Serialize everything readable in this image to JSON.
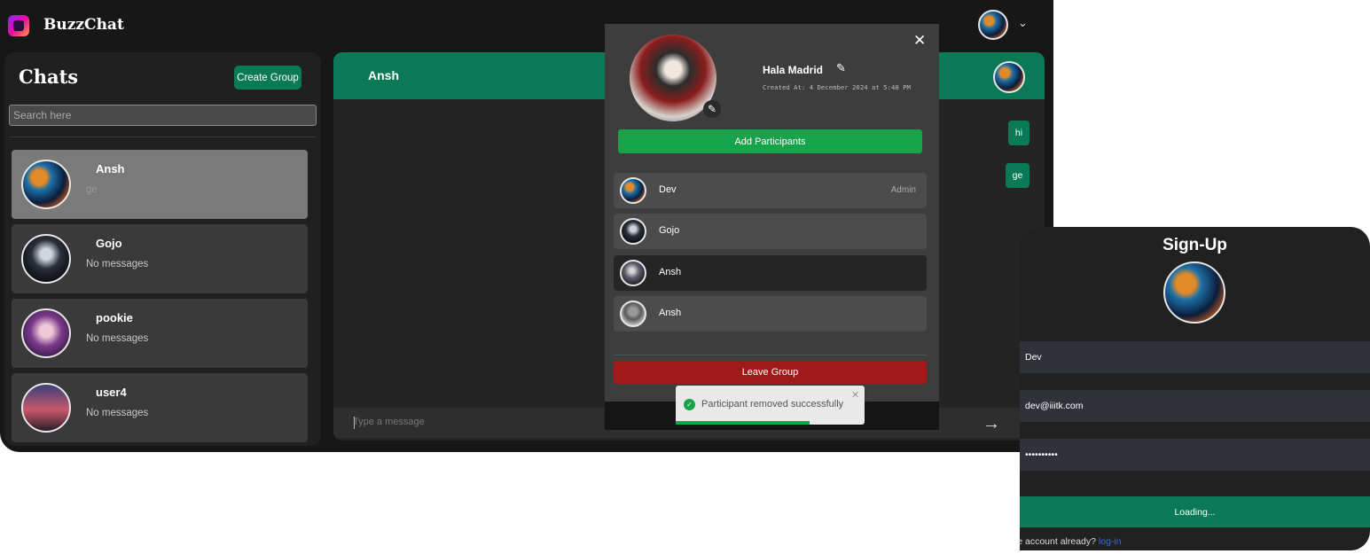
{
  "app": {
    "brand": "BuzzChat",
    "top_avatar_icon": "user-avatar",
    "menu_icon": "chevron-down-icon"
  },
  "sidebar": {
    "title": "Chats",
    "create_group_label": "Create Group",
    "search_placeholder": "Search here",
    "chats": [
      {
        "name": "Ansh",
        "last_message": "ge",
        "active": true
      },
      {
        "name": "Gojo",
        "last_message": "No messages",
        "active": false
      },
      {
        "name": "pookie",
        "last_message": "No messages",
        "active": false
      },
      {
        "name": "user4",
        "last_message": "No messages",
        "active": false
      }
    ]
  },
  "chat": {
    "header_name": "Ansh",
    "messages": [
      {
        "text": "hi",
        "sent": true
      },
      {
        "text": "ge",
        "sent": true
      }
    ],
    "input_placeholder": "Type a message",
    "send_icon": "arrow-right-icon"
  },
  "group_modal": {
    "name": "Hala Madrid",
    "created": "Created At: 4 December 2024 at 5:48 PM",
    "add_participants_label": "Add Participants",
    "participants": [
      {
        "name": "Dev",
        "role": "Admin"
      },
      {
        "name": "Gojo",
        "role": ""
      },
      {
        "name": "Ansh",
        "role": ""
      },
      {
        "name": "Ansh",
        "role": ""
      }
    ],
    "leave_label": "Leave Group",
    "close_icon": "close-icon"
  },
  "toast": {
    "message": "Participant removed successfully",
    "progress": 0.71
  },
  "signup": {
    "title": "Sign-Up",
    "name_value": "Dev",
    "email_value": "dev@iiitk.com",
    "password_value": "••••••••••",
    "button_label": "Loading...",
    "login_prompt": "ve account already?",
    "login_link": "log-in"
  },
  "colors": {
    "accent_green": "#0a7a56",
    "add_green": "#16a34a",
    "danger_red": "#a11a1a",
    "background": "#171717"
  }
}
